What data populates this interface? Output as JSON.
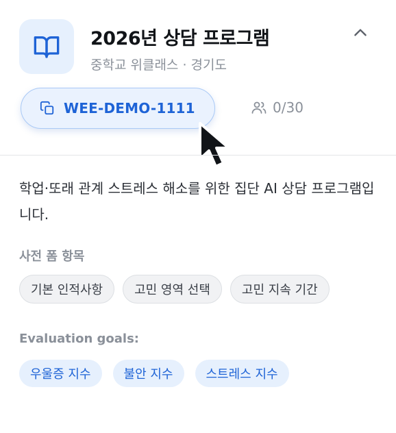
{
  "program": {
    "title": "2026년 상담 프로그램",
    "subtitle": "중학교 위클래스 · 경기도",
    "code": "WEE-DEMO-1111",
    "members": "0/30",
    "description": "학업·또래 관계 스트레스 해소를 위한 집단 AI 상담 프로그램입니다."
  },
  "pre_form": {
    "title": "사전 폼 항목",
    "items": [
      "기본 인적사항",
      "고민 영역 선택",
      "고민 지속 기간"
    ]
  },
  "evaluation": {
    "title": "Evaluation goals:",
    "items": [
      "우울증 지수",
      "불안 지수",
      "스트레스 지수"
    ]
  },
  "icons": {
    "logo": "book-open-icon",
    "collapse": "chevron-up-icon",
    "copy": "copy-icon",
    "members": "users-icon",
    "cursor": "mouse-pointer-icon"
  },
  "colors": {
    "accent": "#1e63d6",
    "accent_bg": "#e6f0fd",
    "muted_text": "#8a9099"
  }
}
